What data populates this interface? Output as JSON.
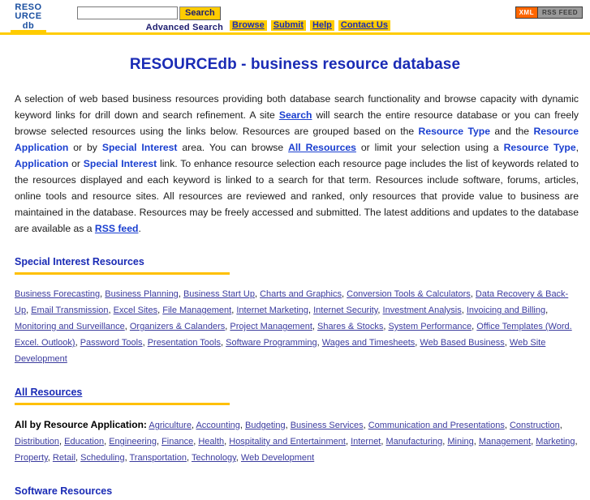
{
  "header": {
    "logo": {
      "line1": "RESO",
      "line2": "URCE",
      "line3": "db"
    },
    "search": {
      "value": "",
      "placeholder": "",
      "button_label": "Search",
      "advanced_label": "Advanced Search"
    },
    "nav": [
      {
        "label": "Browse"
      },
      {
        "label": "Submit"
      },
      {
        "label": "Help"
      },
      {
        "label": "Contact Us"
      }
    ],
    "rss": {
      "xml_label": "XML",
      "feed_label": "RSS FEED"
    },
    "colors": {
      "accent_yellow": "#ffcc00",
      "brand_blue": "#1a2bb5",
      "link_blue": "#3b3b9e",
      "xml_orange": "#ff6600"
    }
  },
  "page_title": "RESOURCEdb - business resource database",
  "intro": {
    "p1_a": "A selection of web based business resources providing both database search functionality and browse capacity with dynamic keyword links for drill down and search refinement. A site ",
    "link_search": "Search",
    "p1_b": " will search the entire resource database or you can freely browse selected resources using the links below. Resources are grouped based on the ",
    "link_resource_type_1": "Resource Type",
    "p1_c": " and the ",
    "link_resource_application_1": "Resource Application",
    "p1_d": " or by ",
    "link_special_interest_1": "Special Interest",
    "p1_e": " area. You can browse ",
    "link_all_resources": "All Resources",
    "p1_f": " or limit your selection using a ",
    "link_resource_type_2": "Resource Type",
    "p1_g": ", ",
    "link_application_2": "Application",
    "p1_h": " or ",
    "link_special_interest_2": "Special Interest",
    "p1_i": " link. To enhance resource selection each resource page includes the list of keywords related to the resources displayed and each keyword is linked to a search for that term. Resources include software, forums, articles, online tools and resource sites. All resources are reviewed and ranked, only resources that provide value to business are maintained in the database. Resources may be freely accessed and submitted. The latest additions and updates to the database are available as a ",
    "link_rss_feed": "RSS feed",
    "p1_j": "."
  },
  "special_interest": {
    "heading": "Special Interest Resources",
    "links": [
      "Business Forecasting",
      "Business Planning",
      "Business Start Up",
      "Charts and Graphics",
      "Conversion Tools & Calculators",
      "Data Recovery & Back-Up",
      "Email Transmission",
      "Excel Sites",
      "File Management",
      "Internet Marketing",
      "Internet Security",
      "Investment Analysis",
      "Invoicing and Billing",
      "Monitoring and Surveillance",
      "Organizers & Calanders",
      "Project Management",
      "Shares & Stocks",
      "System Performance",
      "Office Templates (Word. Excel. Outlook)",
      "Password Tools",
      "Presentation Tools",
      "Software Programming",
      "Wages and Timesheets",
      "Web Based Business",
      "Web Site Development"
    ]
  },
  "all_resources": {
    "heading": "All Resources",
    "lead": "All by Resource Application:",
    "links": [
      "Agriculture",
      "Accounting",
      "Budgeting",
      "Business Services",
      "Communication and Presentations",
      "Construction",
      "Distribution",
      "Education",
      "Engineering",
      "Finance",
      "Health",
      "Hospitality and Entertainment",
      "Internet",
      "Manufacturing",
      "Mining",
      "Management",
      "Marketing",
      "Property",
      "Retail",
      "Scheduling",
      "Transportation",
      "Technology",
      "Web Development"
    ]
  },
  "software_resources": {
    "heading": "Software Resources"
  }
}
